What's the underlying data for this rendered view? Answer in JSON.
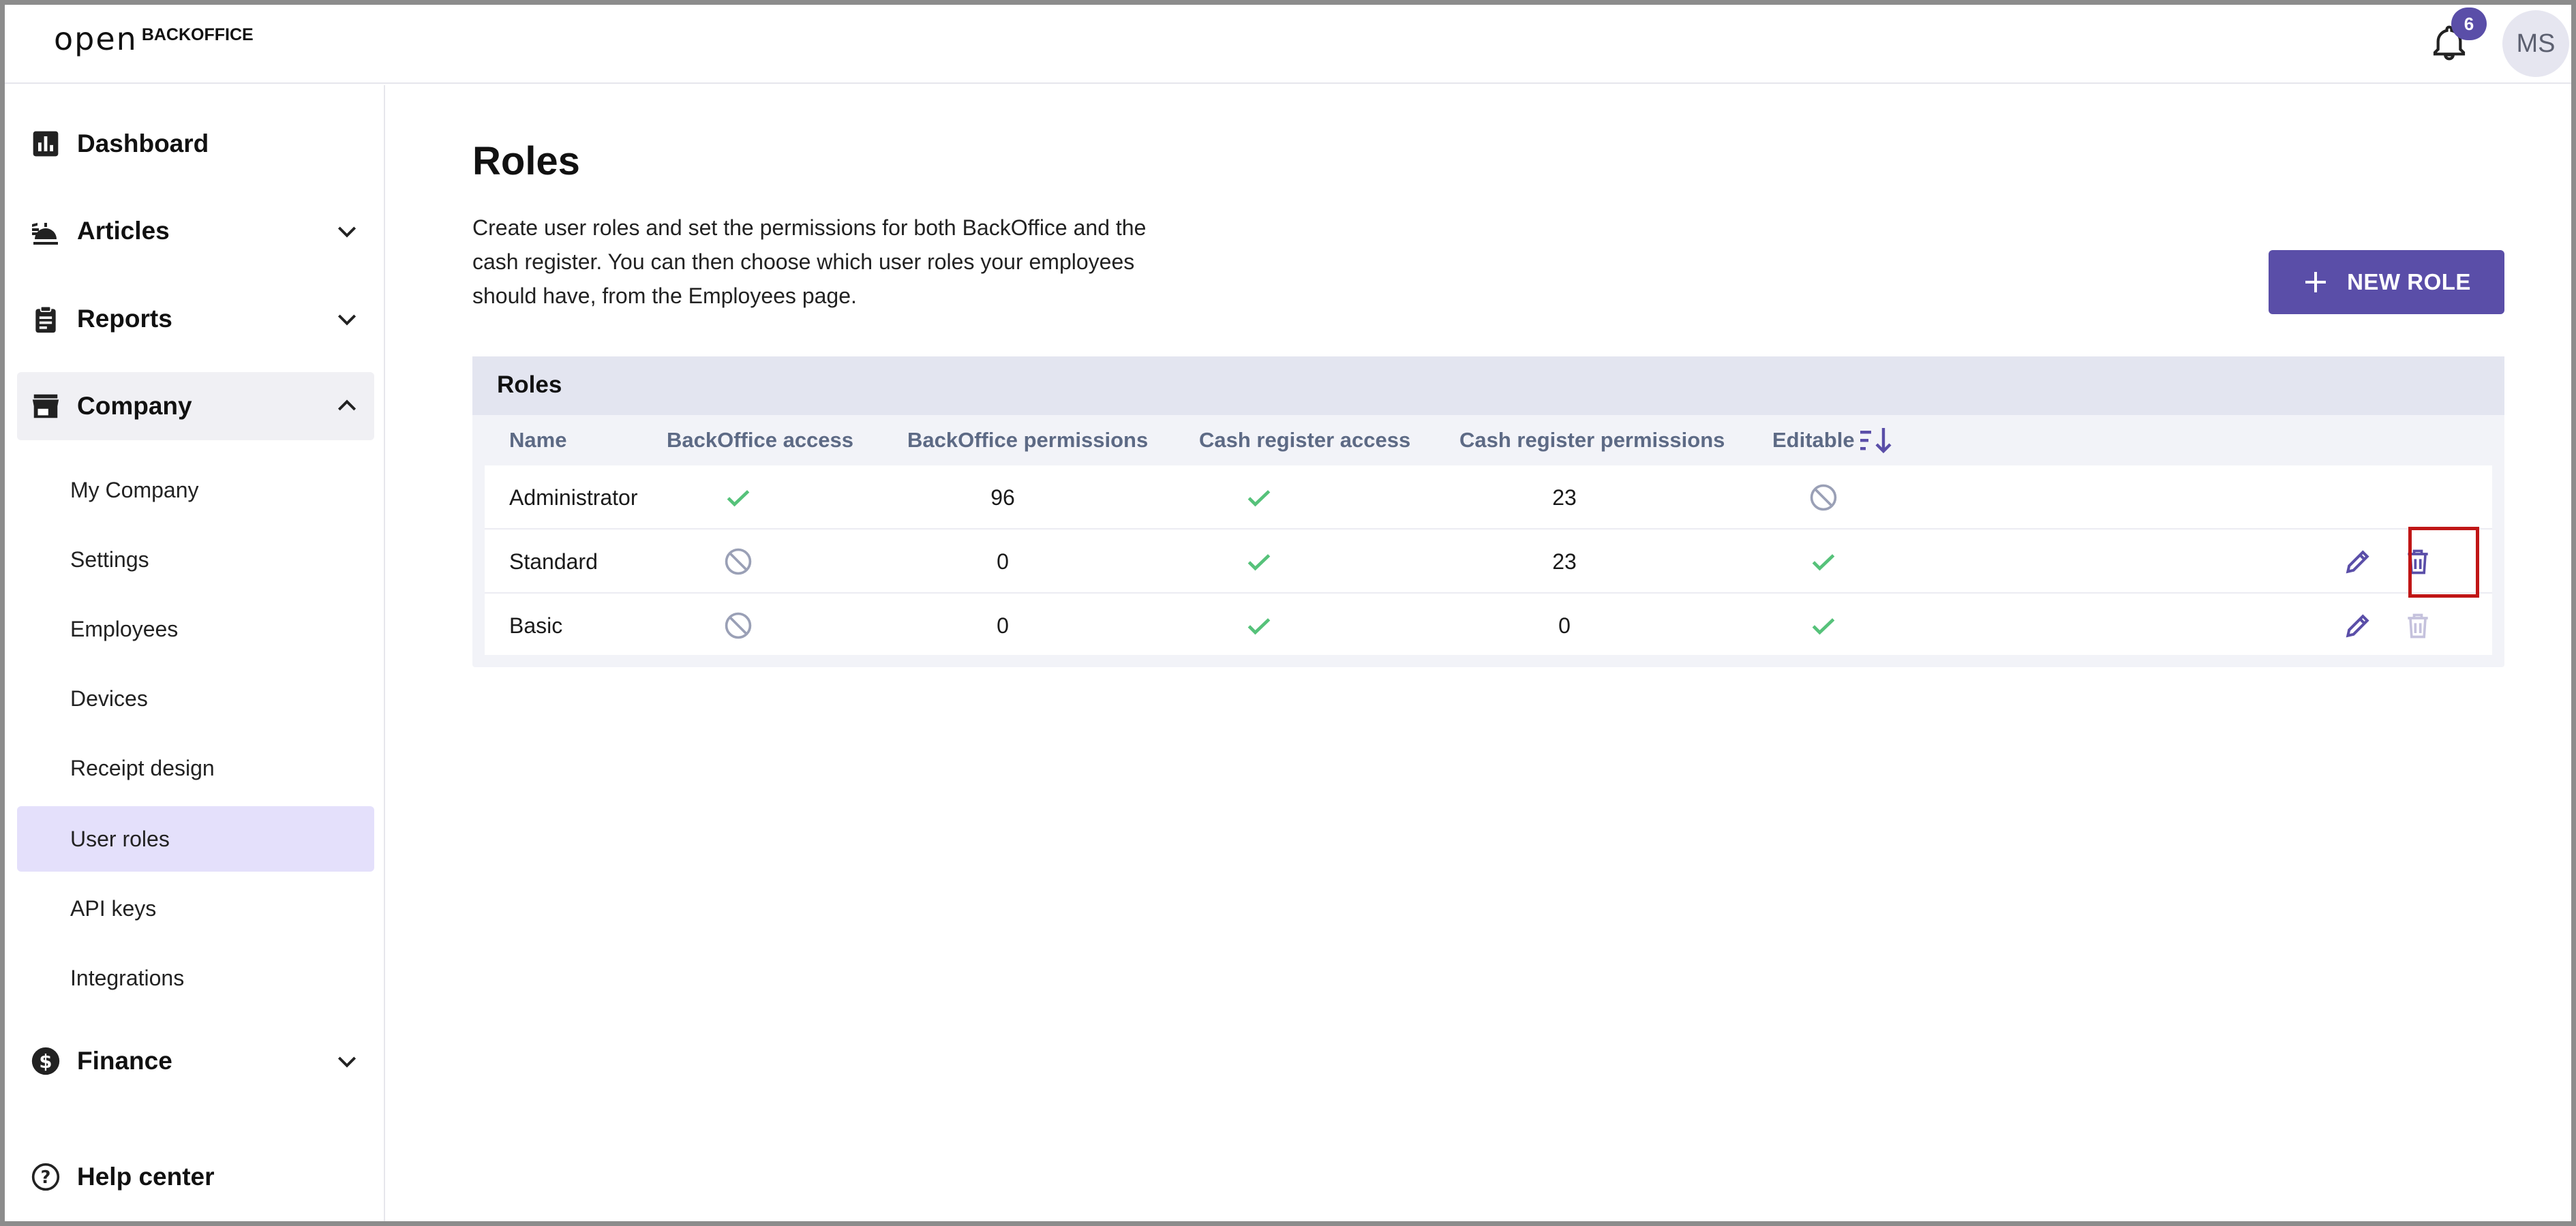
{
  "header": {
    "logo_mark": "open",
    "logo_text": "BACKOFFICE",
    "notification_count": "6",
    "user_initials": "MS"
  },
  "sidebar": {
    "dashboard": "Dashboard",
    "articles": "Articles",
    "reports": "Reports",
    "company": "Company",
    "company_items": [
      "My Company",
      "Settings",
      "Employees",
      "Devices",
      "Receipt design",
      "User roles",
      "API keys",
      "Integrations"
    ],
    "finance": "Finance",
    "help": "Help center",
    "selected_item": "User roles"
  },
  "main": {
    "title": "Roles",
    "description": "Create user roles and set the permissions for both BackOffice and the cash register. You can then choose which user roles your employees should have, from the Employees page.",
    "new_role_button": "NEW ROLE",
    "table": {
      "title": "Roles",
      "columns": [
        "Name",
        "BackOffice access",
        "BackOffice permissions",
        "Cash register access",
        "Cash register permissions",
        "Editable"
      ],
      "rows": [
        {
          "name": "Administrator",
          "backoffice_access": "check",
          "backoffice_permissions": "96",
          "cash_register_access": "check",
          "cash_register_permissions": "23",
          "editable": "blocked"
        },
        {
          "name": "Standard",
          "backoffice_access": "blocked",
          "backoffice_permissions": "0",
          "cash_register_access": "check",
          "cash_register_permissions": "23",
          "editable": "check"
        },
        {
          "name": "Basic",
          "backoffice_access": "blocked",
          "backoffice_permissions": "0",
          "cash_register_access": "check",
          "cash_register_permissions": "0",
          "editable": "check"
        }
      ]
    }
  },
  "colors": {
    "accent": "#5a4ea8",
    "check": "#56c27a",
    "blocked": "#9aa0b6",
    "selected_bg": "#e4e0fb",
    "highlight": "#c01616"
  }
}
